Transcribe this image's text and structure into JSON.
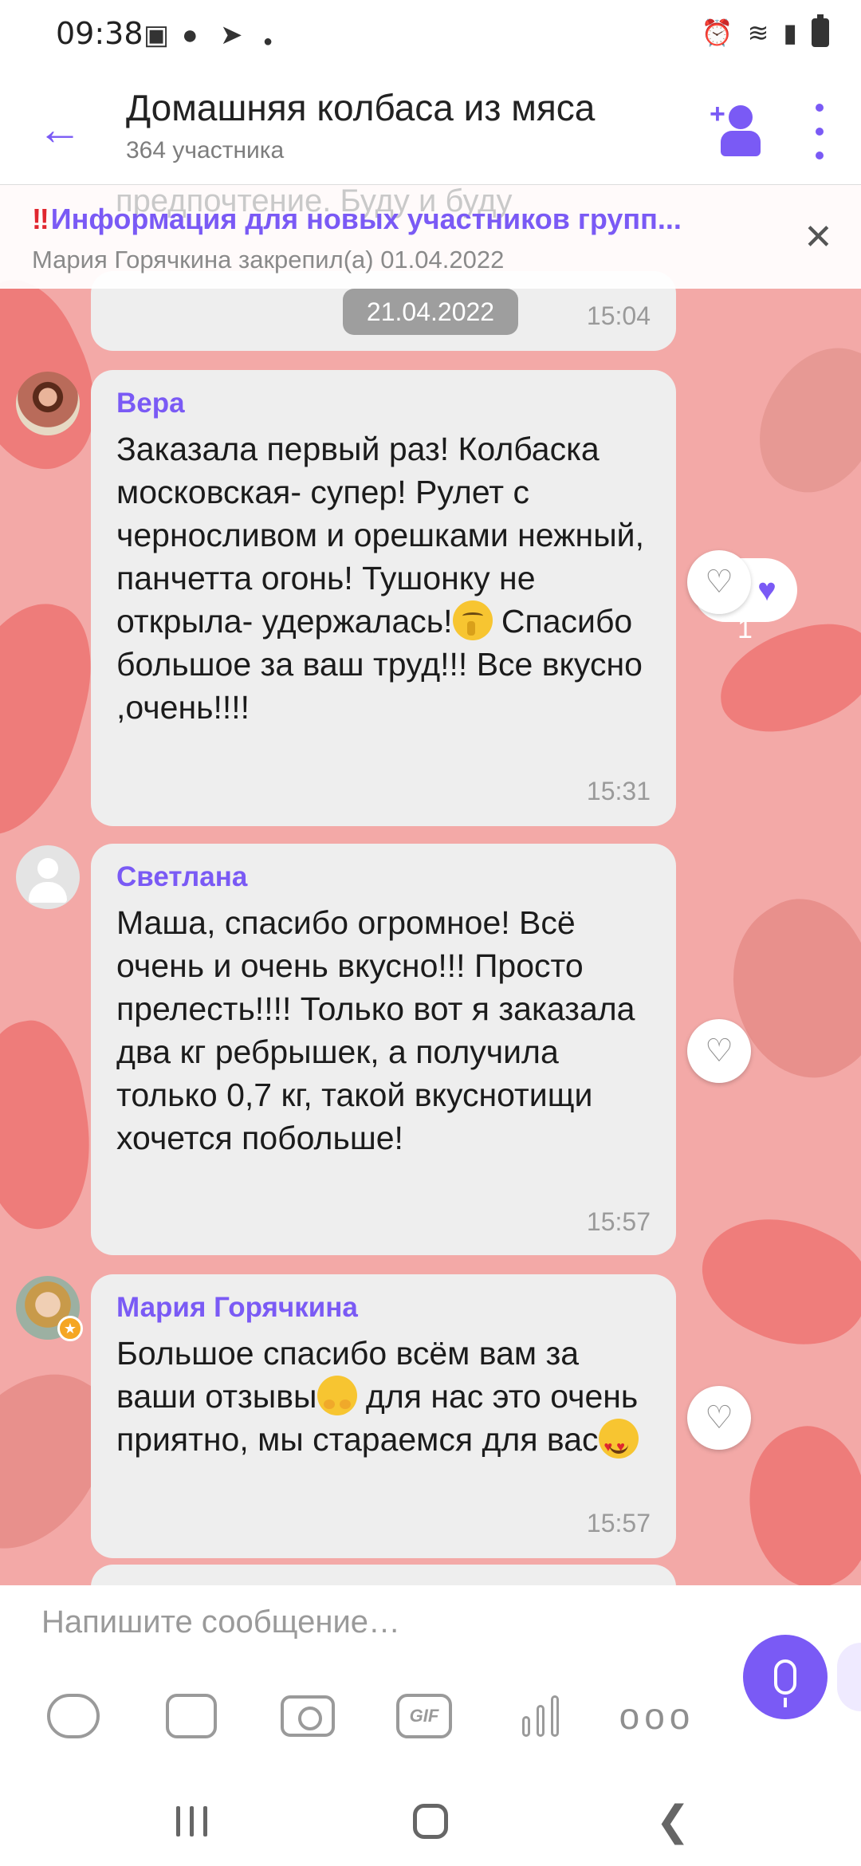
{
  "status_bar": {
    "time": "09:38"
  },
  "header": {
    "title": "Домашняя колбаса из мяса",
    "subtitle": "364 участника"
  },
  "pinned": {
    "ghost_text": "предпочтение. Буду и буду",
    "title": "Информация для новых участников групп...",
    "subtitle": "Мария Горячкина закрепил(а) 01.04.2022"
  },
  "date_chip": "21.04.2022",
  "messages": [
    {
      "time": "15:04"
    },
    {
      "sender": "Вера",
      "text_before_emoji": "Заказала первый раз! Колбаска московская- супер! Рулет с черносливом и орешками нежный, панчетта огонь! Тушонку не открыла- удержалась!",
      "text_after_emoji": " Спасибо большое за ваш труд!!! Все вкусно ,очень!!!!",
      "time": "15:31",
      "likes": "1"
    },
    {
      "sender": "Светлана",
      "text": "Маша, спасибо огромное! Всё очень и очень вкусно!!! Просто прелесть!!!! Только вот я заказала два кг ребрышек, а получила только 0,7 кг, такой вкуснотищи хочется побольше!",
      "time": "15:57"
    },
    {
      "sender": "Мария Горячкина",
      "text_before_emoji": "Большое спасибо всём вам за ваши отзывы",
      "text_middle": " для нас это очень приятно, мы стараемся для вас",
      "time": "15:57"
    }
  ],
  "composer": {
    "placeholder": "Напишите сообщение…",
    "gif_label": "GIF",
    "more_label": "ooo"
  },
  "colors": {
    "accent": "#7a5af5",
    "chat_background": "#f3a9a7",
    "bubble": "#eeeeee"
  }
}
